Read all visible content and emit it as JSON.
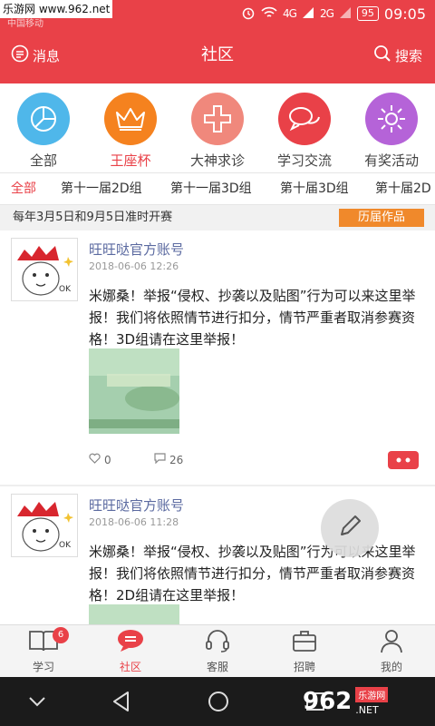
{
  "status_bar": {
    "watermark": "乐游网 www.962.net",
    "carrier": "中国移动",
    "network1": "4G",
    "network2": "2G",
    "battery": "95",
    "time": "09:05"
  },
  "header": {
    "messages_label": "消息",
    "title": "社区",
    "search_label": "搜索"
  },
  "categories": [
    {
      "label": "全部",
      "color": "#4fb7ea",
      "icon": "pie-chart-icon"
    },
    {
      "label": "王座杯",
      "color": "#f5821f",
      "icon": "crown-icon",
      "active": true
    },
    {
      "label": "大神求诊",
      "color": "#f0887c",
      "icon": "medical-cross-icon"
    },
    {
      "label": "学习交流",
      "color": "#e94148",
      "icon": "chat-bubbles-icon"
    },
    {
      "label": "有奖活动",
      "color": "#b563d8",
      "icon": "sun-icon"
    }
  ],
  "tabs": [
    "全部",
    "第十一届2D组",
    "第十一届3D组",
    "第十届3D组",
    "第十届2D"
  ],
  "notice": {
    "text": "每年3月5日和9月5日准时开赛",
    "button": "历届作品"
  },
  "posts": [
    {
      "author": "旺旺哒官方账号",
      "time": "2018-06-06 12:26",
      "body": "米娜桑！举报“侵权、抄袭以及贴图”行为可以来这里举报！我们将依照情节进行扣分，情节严重者取消参赛资格！3D组请在这里举报！",
      "likes": "0",
      "comments": "26"
    },
    {
      "author": "旺旺哒官方账号",
      "time": "2018-06-06 11:28",
      "body": "米娜桑！举报“侵权、抄袭以及贴图”行为可以来这里举报！我们将依照情节进行扣分，情节严重者取消参赛资格！2D组请在这里举报！",
      "likes": "",
      "comments": ""
    }
  ],
  "bottom_nav": [
    {
      "label": "学习",
      "icon": "book-icon",
      "badge": "6"
    },
    {
      "label": "社区",
      "icon": "chat-icon",
      "active": true
    },
    {
      "label": "客服",
      "icon": "headset-icon"
    },
    {
      "label": "招聘",
      "icon": "briefcase-icon"
    },
    {
      "label": "我的",
      "icon": "person-icon"
    }
  ],
  "site_mark": {
    "logo": "962",
    "sub": "乐游网",
    "url": ".NET"
  },
  "colors": {
    "brand": "#e94148",
    "notice_button": "#f0892b",
    "author": "#5b6aa0"
  }
}
